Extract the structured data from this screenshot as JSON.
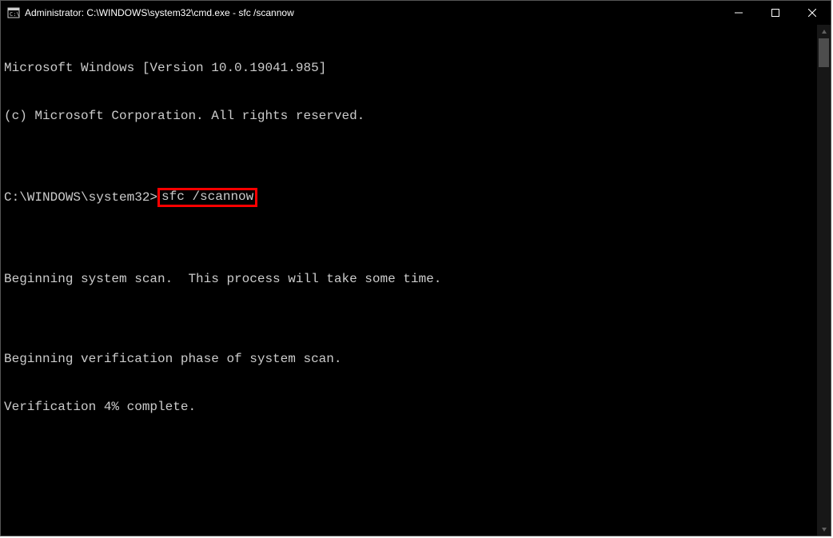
{
  "window": {
    "title": "Administrator: C:\\WINDOWS\\system32\\cmd.exe - sfc  /scannow"
  },
  "terminal": {
    "line1": "Microsoft Windows [Version 10.0.19041.985]",
    "line2": "(c) Microsoft Corporation. All rights reserved.",
    "blank1": "",
    "prompt": "C:\\WINDOWS\\system32>",
    "command": "sfc /scannow",
    "blank2": "",
    "scan_begin": "Beginning system scan.  This process will take some time.",
    "blank3": "",
    "verify_begin": "Beginning verification phase of system scan.",
    "verify_progress": "Verification 4% complete."
  }
}
